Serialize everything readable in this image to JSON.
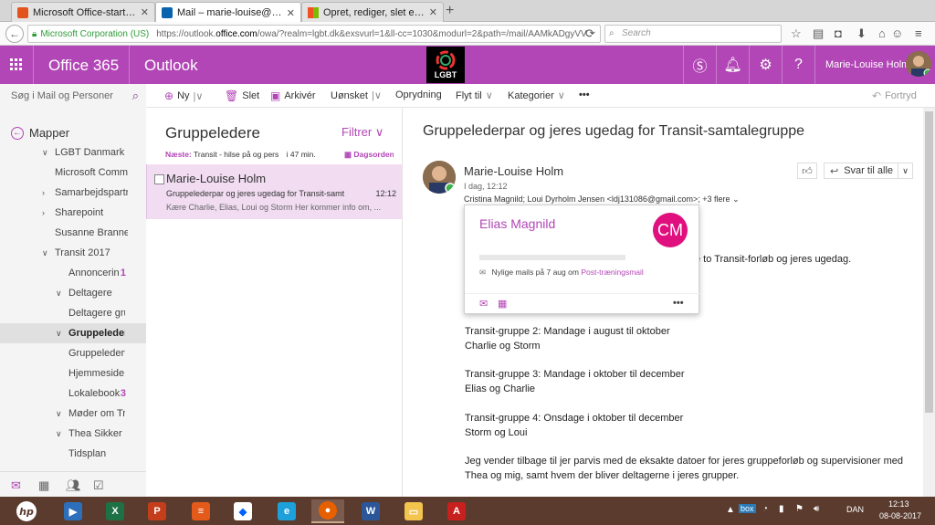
{
  "browser": {
    "tabs": [
      {
        "title": "Microsoft Office-startside"
      },
      {
        "title": "Mail – marie-louise@lgbt.dk"
      },
      {
        "title": "Opret, rediger, slet eller genop"
      }
    ],
    "url_identity": "Microsoft Corporation (US)",
    "url_prefix": "https://outlook.",
    "url_domain": "office.com",
    "url_path": "/owa/?realm=lgbt.dk&exsvurl=1&ll-cc=1030&modurl=2&path=/mail/AAMkADgyVV",
    "search_placeholder": "Search"
  },
  "header": {
    "product": "Office 365",
    "app": "Outlook",
    "logo_text": "LGBT",
    "user_name": "Marie-Louise Holm",
    "accent": "#b246b6"
  },
  "commands": {
    "search_mail": "Søg i Mail og Personer",
    "new": "Ny",
    "delete": "Slet",
    "archive": "Arkivér",
    "junk": "Uønsket",
    "sweep": "Oprydning",
    "move": "Flyt til",
    "categories": "Kategorier",
    "undo": "Fortryd"
  },
  "folders": {
    "header": "Mapper",
    "items": [
      {
        "label": "LGBT Danmark",
        "count": ""
      },
      {
        "label": "Microsoft Commu",
        "count": ""
      },
      {
        "label": "Samarbejdspartn",
        "count": ""
      },
      {
        "label": "Sharepoint",
        "count": ""
      },
      {
        "label": "Susanne Branner",
        "count": ""
      },
      {
        "label": "Transit 2017",
        "count": ""
      },
      {
        "label": "Annoncerin",
        "count": "1"
      },
      {
        "label": "Deltagere",
        "count": ""
      },
      {
        "label": "Deltagere gru",
        "count": ""
      },
      {
        "label": "Gruppeledere",
        "count": ""
      },
      {
        "label": "Gruppeledertr",
        "count": ""
      },
      {
        "label": "Hjemmeside",
        "count": ""
      },
      {
        "label": "Lokalebook",
        "count": "3"
      },
      {
        "label": "Møder om Tra",
        "count": ""
      },
      {
        "label": "Thea Sikker Re",
        "count": ""
      },
      {
        "label": "Tidsplan",
        "count": ""
      }
    ]
  },
  "message_list": {
    "title": "Gruppeledere",
    "filter": "Filtrer",
    "next_label": "Næste:",
    "next_text": "Transit - hilse på og pers",
    "next_time": "i 47 min.",
    "agenda": "Dagsorden",
    "items": [
      {
        "from": "Marie-Louise Holm",
        "subject": "Gruppelederpar og jeres ugedag for Transit-samt",
        "time": "12:12",
        "preview": "Kære Charlie, Elias, Loui og Storm Her kommer info om, ..."
      }
    ]
  },
  "reading": {
    "subject": "Gruppelederpar og jeres ugedag for Transit-samtalegruppe",
    "sender": "Marie-Louise Holm",
    "date": "I dag, 12:12",
    "recipients": "Cristina Magnild; Loui Dyrholm Jensen <ldj131086@gmail.com>;",
    "more_recipients": "+3 flere",
    "reply_all": "Svar til alle",
    "body": [
      "e to Transit-forløb og jeres ugedag.",
      "Transit-gruppe 2: Mandage i august til oktober",
      "Charlie og Storm",
      "Transit-gruppe 3: Mandage i oktober til december",
      "Elias og Charlie",
      "Transit-gruppe 4: Onsdage i oktober til december",
      "Storm og Loui",
      "Jeg vender tilbage til jer parvis med de eksakte datoer for jeres gruppeforløb og supervisioner med",
      "Thea og mig, samt hvem der bliver deltagerne i jeres grupper."
    ]
  },
  "contact_card": {
    "name": "Elias Magnild",
    "initials": "CM",
    "recent_prefix": "Nylige mails på 7 aug om",
    "recent_link": "Post-træningsmail"
  },
  "taskbar": {
    "language": "DAN",
    "time": "12:13",
    "date": "08-08-2017"
  }
}
